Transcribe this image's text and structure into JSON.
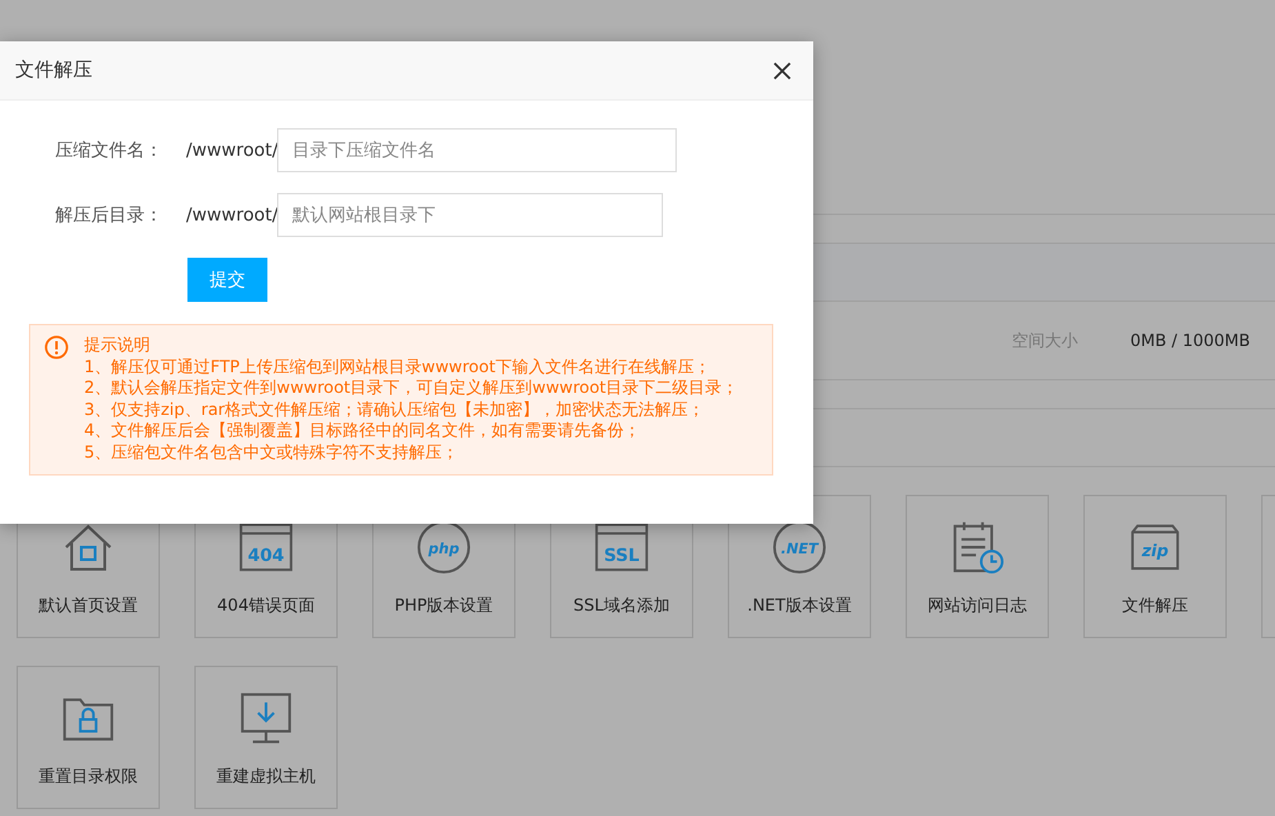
{
  "background": {
    "info_row": {
      "label": "空间大小",
      "value": "0MB / 1000MB"
    },
    "tools": [
      {
        "kind": "home",
        "label": "默认首页设置"
      },
      {
        "kind": "page",
        "icon_text": "404",
        "label": "404错误页面"
      },
      {
        "kind": "circle",
        "icon_text": "php",
        "label": "PHP版本设置"
      },
      {
        "kind": "page",
        "icon_text": "SSL",
        "label": "SSL域名添加"
      },
      {
        "kind": "circle",
        "icon_text": ".NET",
        "label": ".NET版本设置"
      },
      {
        "kind": "log",
        "label": "网站访问日志"
      },
      {
        "kind": "zip",
        "icon_text": "zip",
        "label": "文件解压"
      },
      {
        "kind": "unknown"
      },
      {
        "kind": "folder",
        "label": "重置目录权限"
      },
      {
        "kind": "monitor",
        "label": "重建虚拟主机"
      }
    ]
  },
  "dialog": {
    "title": "文件解压",
    "fields": [
      {
        "label": "压缩文件名：",
        "prefix": "/wwwroot/",
        "placeholder": "目录下压缩文件名"
      },
      {
        "label": "解压后目录：",
        "prefix": "/wwwroot/",
        "placeholder": "默认网站根目录下"
      }
    ],
    "submit": "提交",
    "notice": {
      "title": "提示说明",
      "lines": [
        "1、解压仅可通过FTP上传压缩包到网站根目录wwwroot下输入文件名进行在线解压；",
        "2、默认会解压指定文件到wwwroot目录下，可自定义解压到wwwroot目录下二级目录；",
        "3、仅支持zip、rar格式文件解压缩；请确认压缩包【未加密】，加密状态无法解压；",
        "4、文件解压后会【强制覆盖】目标路径中的同名文件，如有需要请先备份；",
        "5、压缩包文件名包含中文或特殊字符不支持解压；"
      ]
    }
  }
}
